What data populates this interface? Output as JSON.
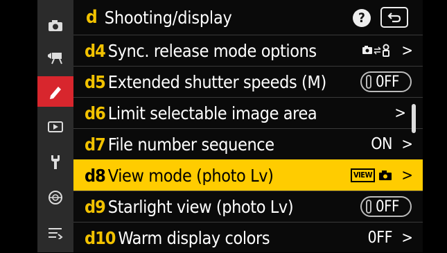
{
  "header": {
    "code": "d",
    "title": "Shooting/display",
    "help_label": "?"
  },
  "sidebar": {
    "items": [
      {
        "icon": "camera-icon"
      },
      {
        "icon": "movie-icon"
      },
      {
        "icon": "pencil-icon"
      },
      {
        "icon": "playback-icon"
      },
      {
        "icon": "wrench-icon"
      },
      {
        "icon": "network-icon"
      },
      {
        "icon": "my-menu-icon"
      }
    ]
  },
  "rows": [
    {
      "code": "d4",
      "label": "Sync. release mode options",
      "value": "",
      "icon": "sync-release-icon"
    },
    {
      "code": "d5",
      "label": "Extended shutter speeds (M)",
      "value": "0FF",
      "kind": "toggle"
    },
    {
      "code": "d6",
      "label": "Limit selectable image area",
      "value": ""
    },
    {
      "code": "d7",
      "label": "File number sequence",
      "value": "ON"
    },
    {
      "code": "d8",
      "label": "View mode (photo Lv)",
      "value": "VIEW",
      "selected": true
    },
    {
      "code": "d9",
      "label": "Starlight view (photo Lv)",
      "value": "0FF",
      "kind": "toggle"
    },
    {
      "code": "d10",
      "label": "Warm display colors",
      "value": "0FF"
    }
  ],
  "chevron": ">"
}
